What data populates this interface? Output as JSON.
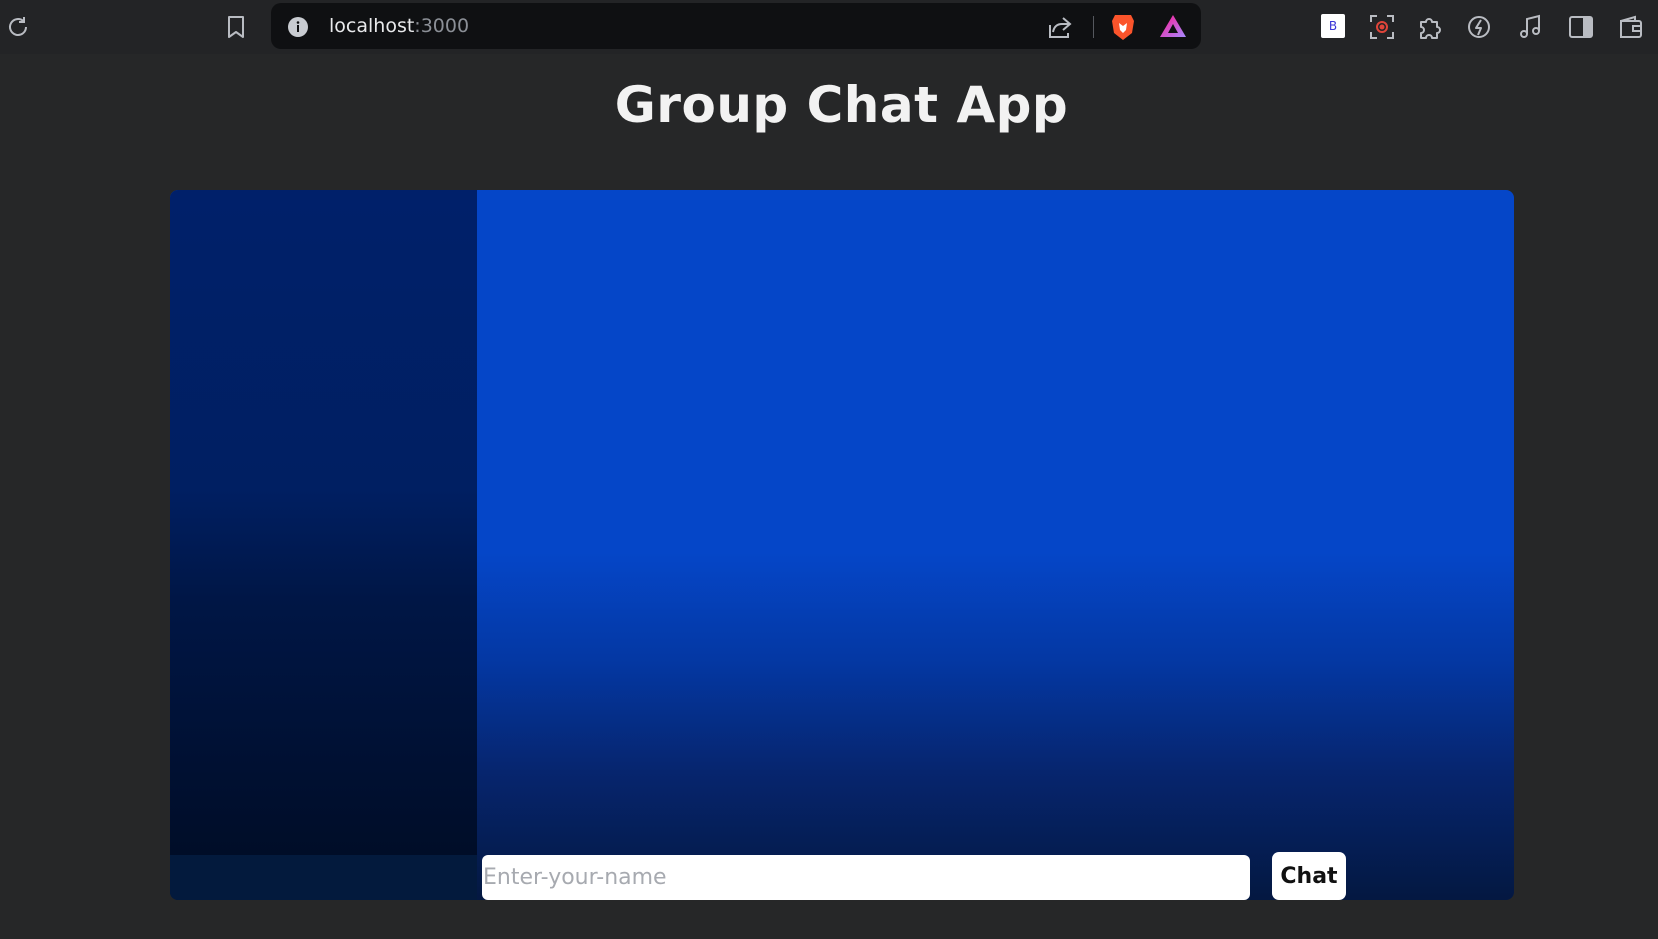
{
  "browser": {
    "url_host": "localhost",
    "url_port": ":3000",
    "icons": {
      "reload": "reload-icon",
      "bookmark": "bookmark-icon",
      "site_info": "info-icon",
      "share": "share-icon",
      "brave_shields": "brave-lion-icon",
      "brave_rewards": "brave-rewards-triangle-icon",
      "extension_b": "B",
      "screen_capture": "screen-capture-icon",
      "extensions": "puzzle-icon",
      "leo": "leo-icon",
      "media": "music-note-icon",
      "sidebar": "sidebar-icon",
      "wallet": "wallet-icon"
    }
  },
  "page": {
    "title": "Group Chat App"
  },
  "chat": {
    "name_input_placeholder": "Enter-your-name",
    "name_input_value": "",
    "chat_button_label": "Chat"
  },
  "colors": {
    "page_background": "#262728",
    "chat_panel_blue": "#0546c8",
    "sidebar_navy": "#00206a",
    "brave_orange": "#fb542b"
  }
}
